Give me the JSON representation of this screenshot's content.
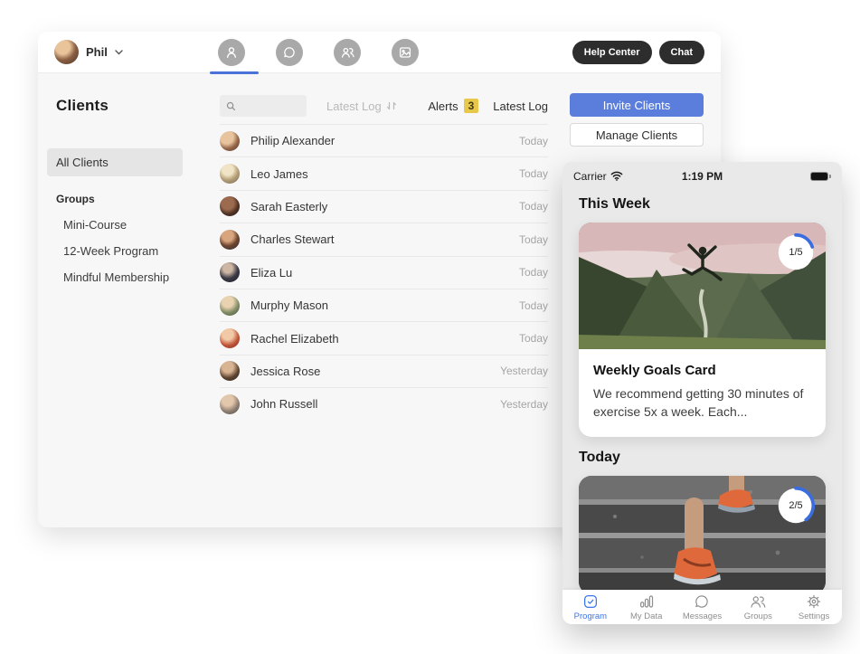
{
  "app": {
    "topbar": {
      "user_name": "Phil",
      "help_center_label": "Help Center",
      "chat_label": "Chat"
    },
    "sidebar": {
      "title": "Clients",
      "all_clients_label": "All Clients",
      "groups_heading": "Groups",
      "groups": [
        {
          "label": "Mini-Course"
        },
        {
          "label": "12-Week Program"
        },
        {
          "label": "Mindful Membership"
        }
      ]
    },
    "toolbar": {
      "sort_label": "Latest Log",
      "alerts_label": "Alerts",
      "alerts_count": "3",
      "column_header": "Latest Log"
    },
    "actions": {
      "invite_label": "Invite Clients",
      "manage_label": "Manage Clients"
    },
    "clients": [
      {
        "name": "Philip Alexander",
        "latest_log": "Today"
      },
      {
        "name": "Leo James",
        "latest_log": "Today"
      },
      {
        "name": "Sarah Easterly",
        "latest_log": "Today"
      },
      {
        "name": "Charles Stewart",
        "latest_log": "Today"
      },
      {
        "name": "Eliza Lu",
        "latest_log": "Today"
      },
      {
        "name": "Murphy Mason",
        "latest_log": "Today"
      },
      {
        "name": "Rachel Elizabeth",
        "latest_log": "Today"
      },
      {
        "name": "Jessica Rose",
        "latest_log": "Yesterday"
      },
      {
        "name": "John Russell",
        "latest_log": "Yesterday"
      }
    ]
  },
  "phone": {
    "statusbar": {
      "carrier": "Carrier",
      "time": "1:19 PM"
    },
    "this_week": {
      "heading": "This Week",
      "progress_badge": "1/5",
      "card_title": "Weekly Goals Card",
      "card_description": "We recommend getting 30 minutes of exercise 5x a week. Each..."
    },
    "today": {
      "heading": "Today",
      "progress_badge": "2/5"
    },
    "tabs": [
      {
        "label": "Program",
        "active": true
      },
      {
        "label": "My Data",
        "active": false
      },
      {
        "label": "Messages",
        "active": false
      },
      {
        "label": "Groups",
        "active": false
      },
      {
        "label": "Settings",
        "active": false
      }
    ]
  },
  "colors": {
    "accent_blue": "#5b7edd",
    "underline_blue": "#4a72d8",
    "tab_active_blue": "#3b76ee",
    "alert_yellow": "#e7c84b",
    "pill_dark": "#2d2d2d"
  }
}
